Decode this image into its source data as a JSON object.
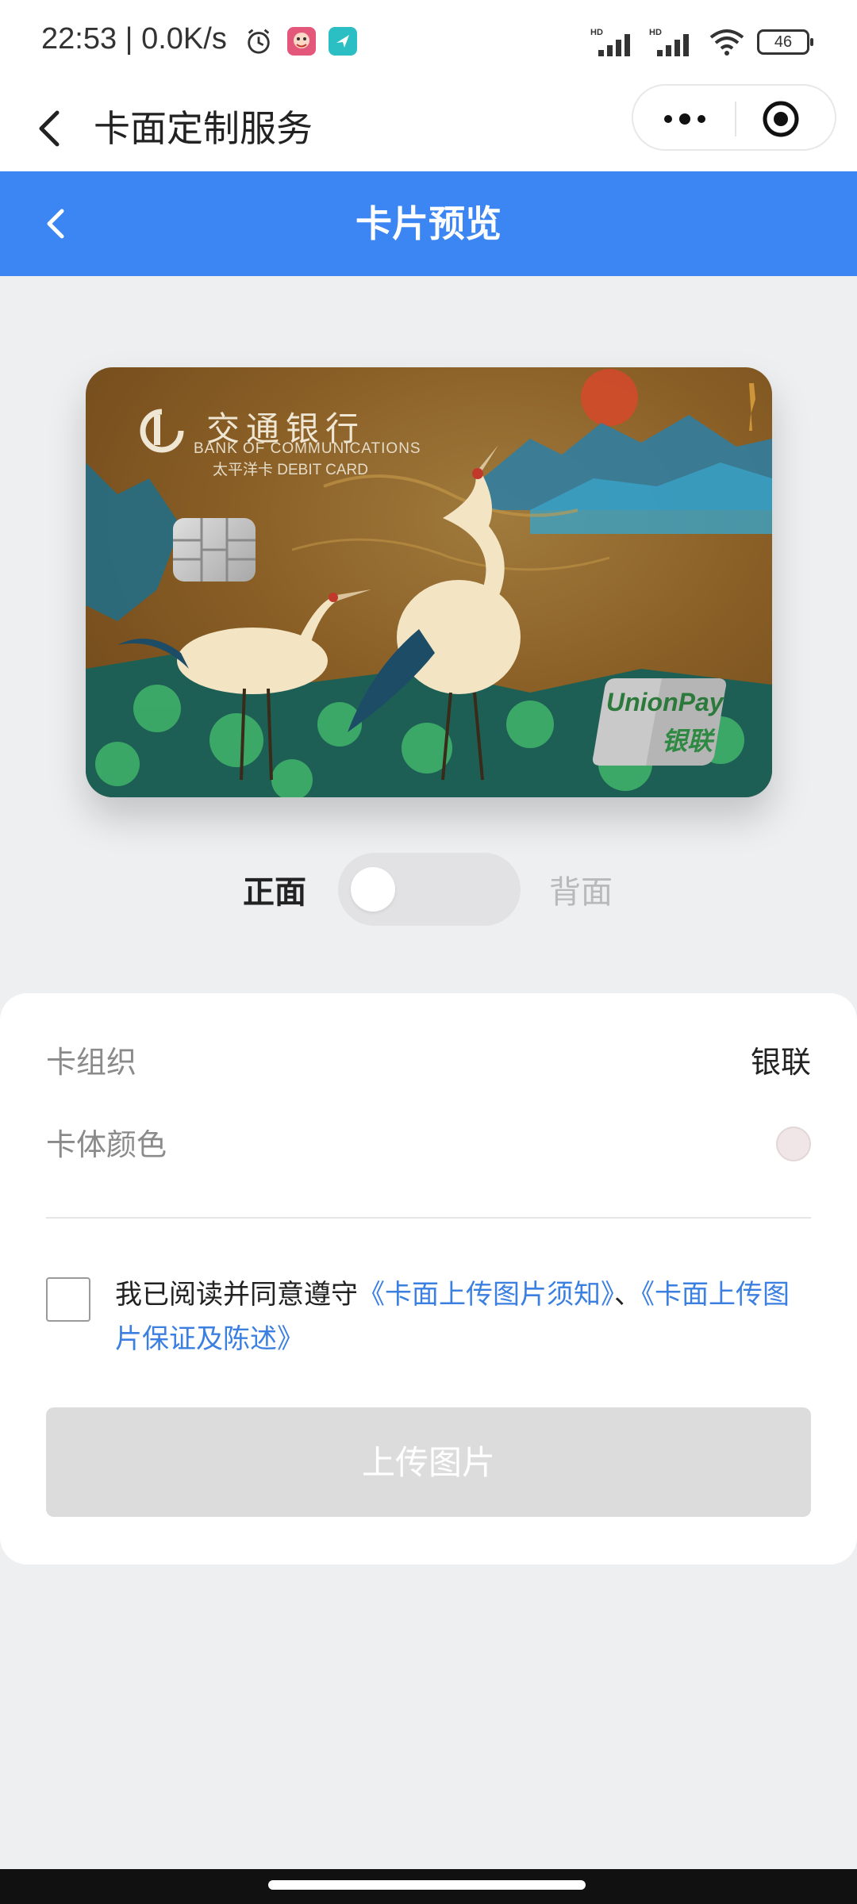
{
  "status_bar": {
    "time": "22:53",
    "speed": "0.0K/s",
    "icons": [
      "alarm-icon",
      "app-notification-icon",
      "location-icon",
      "signal-hd-icon",
      "signal-hd-icon",
      "wifi-icon",
      "battery-icon"
    ],
    "battery": "46",
    "hd_label_1": "HD",
    "hd_label_2": "HD"
  },
  "nav": {
    "back_icon": "back-chevron-icon",
    "title": "卡面定制服务",
    "more_icon": "more-dots-icon",
    "close_icon": "target-close-icon"
  },
  "preview_header": {
    "title": "卡片预览",
    "back_icon": "back-chevron-icon",
    "color": "#3b86f2"
  },
  "card": {
    "bank_name_cn": "交通银行",
    "bank_name_en": "BANK OF COMMUNICATIONS",
    "card_type": "太平洋卡  DEBIT CARD",
    "network_en": "UnionPay",
    "network_cn": "银联"
  },
  "face_toggle": {
    "front_label": "正面",
    "back_label": "背面",
    "selected": "front"
  },
  "details": {
    "org_label": "卡组织",
    "org_value": "银联",
    "color_label": "卡体颜色",
    "color_value": "#f1e6e7"
  },
  "agreement": {
    "text": "我已阅读并同意遵守",
    "link1": "《卡面上传图片须知》",
    "separator": "、",
    "link2": "《卡面上传图片保证及陈述》",
    "checked": false
  },
  "upload_button": {
    "label": "上传图片",
    "enabled": false
  },
  "colors": {
    "accent": "#3b86f2",
    "link": "#3b80e0",
    "disabled_button": "#dcdcdc"
  }
}
